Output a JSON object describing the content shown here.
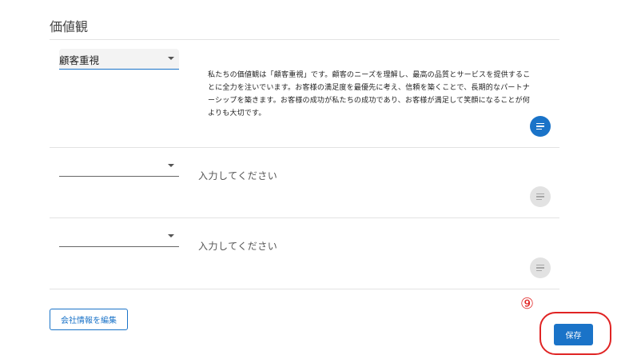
{
  "section": {
    "title": "価値観"
  },
  "rows": [
    {
      "select_value": "顧客重視",
      "text": "私たちの価値観は「顧客重視」です。顧客のニーズを理解し、最高の品質とサービスを提供することに全力を注いでいます。お客様の満足度を最優先に考え、信頼を築くことで、長期的なパートナーシップを築きます。お客様の成功が私たちの成功であり、お客様が満足して笑顔になることが何よりも大切です。",
      "ai_button": "active"
    },
    {
      "select_value": "",
      "placeholder": "入力してください",
      "ai_button": "inactive"
    },
    {
      "select_value": "",
      "placeholder": "入力してください",
      "ai_button": "inactive"
    }
  ],
  "footer": {
    "edit_button": "会社情報を編集",
    "save_button": "保存",
    "step_marker": "⑨"
  },
  "colors": {
    "accent": "#1a73c8",
    "annotation": "#e02424"
  },
  "icons": {
    "dropdown": "chevron-down-icon",
    "text_lines": "text-lines-icon"
  }
}
